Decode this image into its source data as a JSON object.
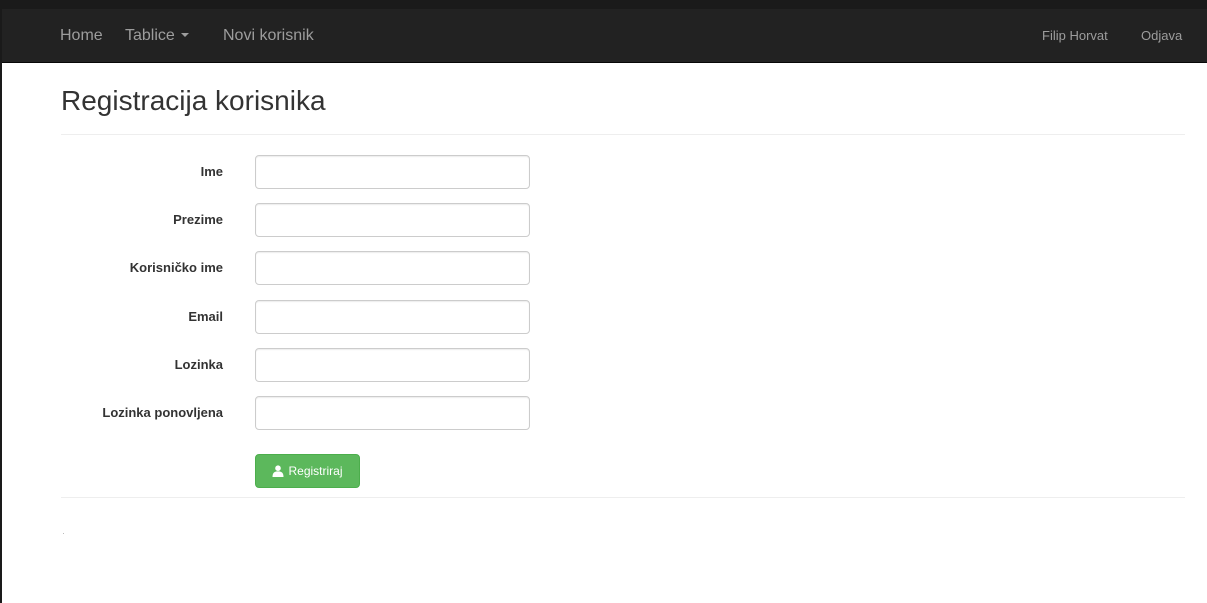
{
  "navbar": {
    "home": "Home",
    "tables": "Tablice",
    "new_user": "Novi korisnik",
    "user_name": "Filip Horvat",
    "logout": "Odjava"
  },
  "page": {
    "title": "Registracija korisnika"
  },
  "form": {
    "fields": [
      {
        "label": "Ime",
        "value": ""
      },
      {
        "label": "Prezime",
        "value": ""
      },
      {
        "label": "Korisničko ime",
        "value": ""
      },
      {
        "label": "Email",
        "value": ""
      },
      {
        "label": "Lozinka",
        "value": ""
      },
      {
        "label": "Lozinka ponovljena",
        "value": ""
      }
    ],
    "submit_label": "Registriraj",
    "submit_icon": "user-icon"
  },
  "colors": {
    "navbar_bg": "#222222",
    "navbar_text": "#9d9d9d",
    "success": "#5cb85c"
  }
}
